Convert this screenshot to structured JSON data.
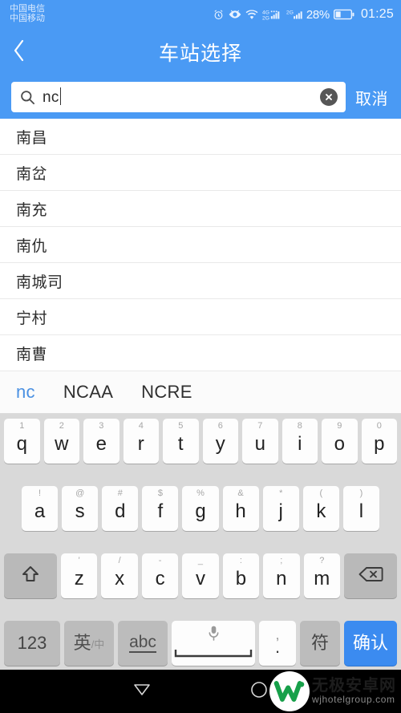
{
  "status_bar": {
    "carrier_primary": "中国电信",
    "carrier_secondary": "中国移动",
    "icons": [
      "alarm-icon",
      "eye-icon",
      "wifi-icon",
      "signal-4g-icon",
      "signal-2g-icon"
    ],
    "battery_percent": "28%",
    "clock": "01:25"
  },
  "header": {
    "back_icon": "chevron-left-icon",
    "title": "车站选择"
  },
  "search": {
    "icon": "search-icon",
    "value": "nc",
    "placeholder": "",
    "clear_icon": "clear-circle-icon",
    "cancel_label": "取消"
  },
  "results": {
    "items": [
      {
        "name": "南昌"
      },
      {
        "name": "南岔"
      },
      {
        "name": "南充"
      },
      {
        "name": "南仇"
      },
      {
        "name": "南城司"
      },
      {
        "name": "宁村"
      },
      {
        "name": "南曹"
      }
    ]
  },
  "candidates": {
    "items": [
      {
        "text": "nc",
        "selected": true
      },
      {
        "text": "NCAA",
        "selected": false
      },
      {
        "text": "NCRE",
        "selected": false
      }
    ]
  },
  "keyboard": {
    "row1": [
      {
        "main": "q",
        "sup": "1"
      },
      {
        "main": "w",
        "sup": "2"
      },
      {
        "main": "e",
        "sup": "3"
      },
      {
        "main": "r",
        "sup": "4"
      },
      {
        "main": "t",
        "sup": "5"
      },
      {
        "main": "y",
        "sup": "6"
      },
      {
        "main": "u",
        "sup": "7"
      },
      {
        "main": "i",
        "sup": "8"
      },
      {
        "main": "o",
        "sup": "9"
      },
      {
        "main": "p",
        "sup": "0"
      }
    ],
    "row2": [
      {
        "main": "a",
        "sup": "!"
      },
      {
        "main": "s",
        "sup": "@"
      },
      {
        "main": "d",
        "sup": "#"
      },
      {
        "main": "f",
        "sup": "$"
      },
      {
        "main": "g",
        "sup": "%"
      },
      {
        "main": "h",
        "sup": "&"
      },
      {
        "main": "j",
        "sup": "*"
      },
      {
        "main": "k",
        "sup": "("
      },
      {
        "main": "l",
        "sup": ")"
      }
    ],
    "row3": [
      {
        "main": "z",
        "sup": "'"
      },
      {
        "main": "x",
        "sup": "/"
      },
      {
        "main": "c",
        "sup": "-"
      },
      {
        "main": "v",
        "sup": "_"
      },
      {
        "main": "b",
        "sup": ":"
      },
      {
        "main": "n",
        "sup": ";"
      },
      {
        "main": "m",
        "sup": "?"
      }
    ],
    "shift_icon": "shift-arrow-icon",
    "backspace_icon": "backspace-icon",
    "row4": {
      "numeric_label": "123",
      "lang_label_main": "英",
      "lang_label_sub": "/中",
      "abc_label": "abc",
      "space_icon": "microphone-icon",
      "comma_top": ",",
      "comma_bottom": ".",
      "symbol_label": "符",
      "enter_label": "确认"
    }
  },
  "navbar": {
    "back_icon": "nav-back-triangle-icon",
    "home_icon": "nav-home-circle-icon",
    "watermark_logo_icon": "w-logo-icon",
    "watermark_cn": "无极安卓网",
    "watermark_en": "wjhotelgroup.com"
  },
  "colors": {
    "accent_blue": "#4a9af4",
    "enter_blue": "#3b8bf0",
    "keyboard_bg": "#d9d9d9",
    "nav_bg": "#000000",
    "logo_green": "#17a04a"
  }
}
